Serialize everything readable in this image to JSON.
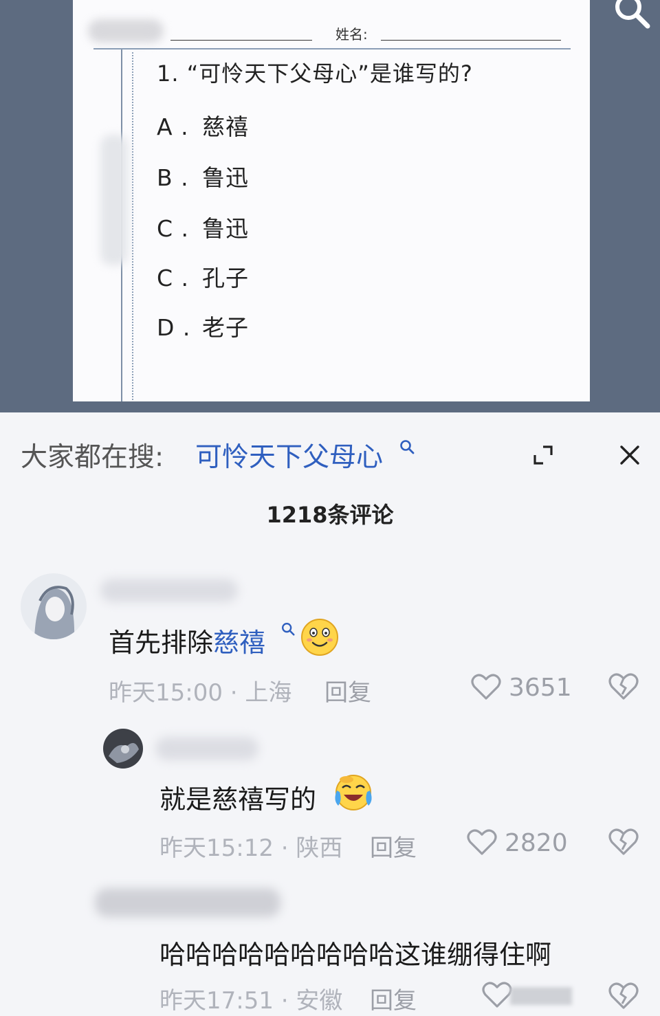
{
  "worksheet": {
    "name_label": "姓名:",
    "question": "1. “可怜天下父母心”是谁写的?",
    "options": [
      {
        "letter": "A .",
        "text": "慈禧"
      },
      {
        "letter": "B .",
        "text": "鲁迅"
      },
      {
        "letter": "C .",
        "text": "鲁迅"
      },
      {
        "letter": "C .",
        "text": "孔子"
      },
      {
        "letter": "D .",
        "text": "老子"
      }
    ]
  },
  "search_bar": {
    "prefix": "大家都在搜:",
    "query": "可怜天下父母心"
  },
  "comments_header": {
    "count_label": "1218条评论"
  },
  "comments": [
    {
      "text_before": "首先排除",
      "link": "慈禧",
      "time": "昨天15:00 · 上海",
      "reply_label": "回复",
      "likes": "3651"
    },
    {
      "text": "就是慈禧写的",
      "time": "昨天15:12 · 陕西",
      "reply_label": "回复",
      "likes": "2820"
    },
    {
      "text": "哈哈哈哈哈哈哈哈哈这谁绷得住啊",
      "time": "昨天17:51 · 安徽",
      "reply_label": "回复"
    }
  ],
  "colors": {
    "link": "#2f5fbf",
    "video_bg": "#5d6b80",
    "panel_bg": "#f4f5f8"
  },
  "icons": [
    "search-icon",
    "expand-icon",
    "close-icon",
    "heart-icon",
    "broken-heart-icon",
    "smile-emoji",
    "laugh-cry-emoji"
  ]
}
